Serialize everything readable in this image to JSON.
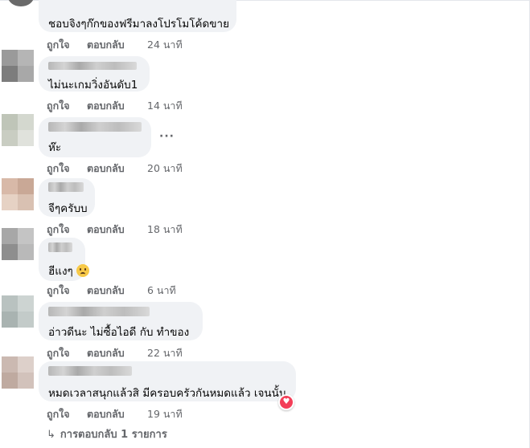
{
  "colors": {
    "bubble": "#f0f2f5",
    "meta_text": "#65676b",
    "reaction_love": "#f33e58"
  },
  "comments": [
    {
      "text": "ชอบจิงๆก๊กของฟรีมาลงโปรโมโค้ดขาย",
      "like_label": "ถูกใจ",
      "reply_label": "ตอบกลับ",
      "time": "24 นาที"
    },
    {
      "text": "ไม่นะเกมวิ่งอันดับ1",
      "like_label": "ถูกใจ",
      "reply_label": "ตอบกลับ",
      "time": "14 นาที"
    },
    {
      "text": "ห๊ะ",
      "like_label": "ถูกใจ",
      "reply_label": "ตอบกลับ",
      "time": "20 นาที"
    },
    {
      "text": "จีๆครับบ",
      "like_label": "ถูกใจ",
      "reply_label": "ตอบกลับ",
      "time": "18 นาที"
    },
    {
      "text": "ฮีแงๆ",
      "like_label": "ถูกใจ",
      "reply_label": "ตอบกลับ",
      "time": "6 นาที",
      "emoji": "sad-face-emoji"
    },
    {
      "text": "อ่าวดีนะ ไม่ซื้อไอดี กับ ทำของ",
      "like_label": "ถูกใจ",
      "reply_label": "ตอบกลับ",
      "time": "22 นาที"
    },
    {
      "text": "หมดเวลาสนุกแล้วสิ มีครอบครัวกันหมดแล้ว เจนนั้น",
      "like_label": "ถูกใจ",
      "reply_label": "ตอบกลับ",
      "time": "19 นาที",
      "reaction": "heart-icon"
    }
  ],
  "more_options_glyph": "···",
  "replies_link": {
    "arrow": "↳",
    "label": "การตอบกลับ 1 รายการ"
  }
}
